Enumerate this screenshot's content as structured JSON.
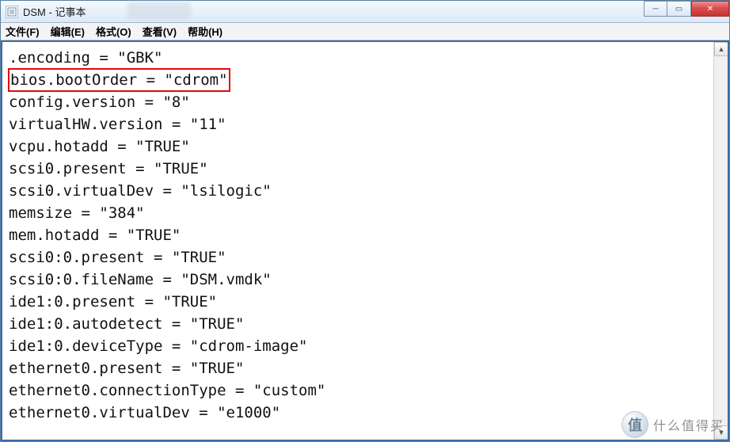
{
  "window": {
    "title": "DSM - 记事本",
    "controls": {
      "min": "─",
      "max": "▭",
      "close": "✕"
    }
  },
  "menu": {
    "file": "文件(F)",
    "edit": "编辑(E)",
    "format": "格式(O)",
    "view": "查看(V)",
    "help": "帮助(H)"
  },
  "highlight_index": 1,
  "lines": [
    ".encoding = \"GBK\"",
    "bios.bootOrder = \"cdrom\"",
    "config.version = \"8\"",
    "virtualHW.version = \"11\"",
    "vcpu.hotadd = \"TRUE\"",
    "scsi0.present = \"TRUE\"",
    "scsi0.virtualDev = \"lsilogic\"",
    "memsize = \"384\"",
    "mem.hotadd = \"TRUE\"",
    "scsi0:0.present = \"TRUE\"",
    "scsi0:0.fileName = \"DSM.vmdk\"",
    "ide1:0.present = \"TRUE\"",
    "ide1:0.autodetect = \"TRUE\"",
    "ide1:0.deviceType = \"cdrom-image\"",
    "ethernet0.present = \"TRUE\"",
    "ethernet0.connectionType = \"custom\"",
    "ethernet0.virtualDev = \"e1000\""
  ],
  "watermark": {
    "icon": "值",
    "text": "什么值得买"
  }
}
